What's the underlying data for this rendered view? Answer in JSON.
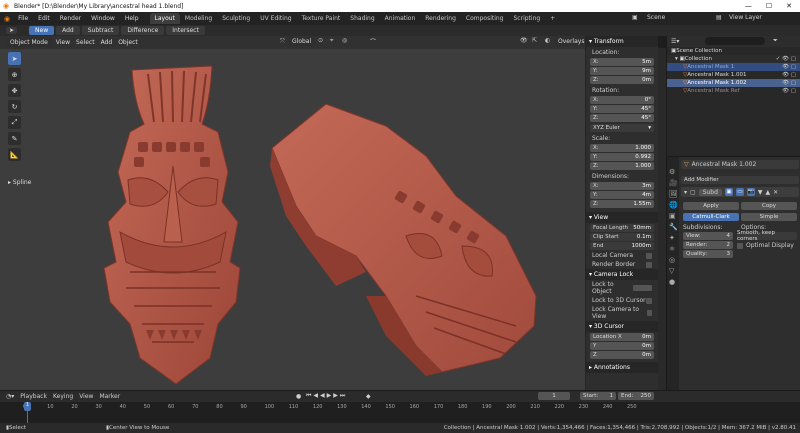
{
  "window": {
    "title": "Blender* [D:\\Blender\\My Library\\ancestral head 1.blend]"
  },
  "menus": [
    "File",
    "Edit",
    "Render",
    "Window",
    "Help"
  ],
  "workspaces": [
    "Layout",
    "Modeling",
    "Sculpting",
    "UV Editing",
    "Texture Paint",
    "Shading",
    "Animation",
    "Rendering",
    "Compositing",
    "Scripting"
  ],
  "scene": {
    "label": "Scene",
    "view_layer": "View Layer"
  },
  "toolhdr": {
    "modes": [
      "New",
      "Add",
      "Subtract",
      "Difference",
      "Intersect"
    ]
  },
  "viewport": {
    "mode": "Object Mode",
    "menus": [
      "View",
      "Select",
      "Add",
      "Object"
    ],
    "orientation": "Global",
    "overlays": "Overlays",
    "shading": "Shading",
    "tool_label": "Spline"
  },
  "npanel": {
    "transform": "Transform",
    "location": "Location:",
    "loc": [
      [
        "X:",
        "5m"
      ],
      [
        "Y:",
        "9m"
      ],
      [
        "Z:",
        "0m"
      ]
    ],
    "rotation": "Rotation:",
    "rot": [
      [
        "X:",
        "0°"
      ],
      [
        "Y:",
        "45°"
      ],
      [
        "Z:",
        "45°"
      ]
    ],
    "euler": "XYZ Euler",
    "scale": "Scale:",
    "scl": [
      [
        "X:",
        "1.000"
      ],
      [
        "Y:",
        "0.992"
      ],
      [
        "Z:",
        "1.000"
      ]
    ],
    "dimensions": "Dimensions:",
    "dim": [
      [
        "X:",
        "3m"
      ],
      [
        "Y:",
        "4m"
      ],
      [
        "Z:",
        "1.55m"
      ]
    ],
    "view": "View",
    "focal_length": [
      "Focal Length",
      "50mm"
    ],
    "clip_start": [
      "Clip Start",
      "0.1m"
    ],
    "clip_end": [
      "End",
      "1000m"
    ],
    "local_camera": "Local Camera",
    "render_border": "Render Border",
    "camera_lock": "Camera Lock",
    "lock_to_object": "Lock to Object",
    "lock_to_3d_cursor": "Lock to 3D Cursor",
    "lock_camera_to_view": "Lock Camera to View",
    "cursor": "3D Cursor",
    "cursor_loc": [
      [
        "Location X",
        "0m"
      ],
      [
        "Y",
        "0m"
      ],
      [
        "Z",
        "0m"
      ]
    ],
    "annotations": "Annotations"
  },
  "outliner": {
    "title": "Scene Collection",
    "collection": "Collection",
    "items": [
      "Ancestral Mask 1",
      "Ancestral Mask 1.001",
      "Ancestral Mask 1.002",
      "Ancestral Mask Ref"
    ]
  },
  "properties": {
    "object_name": "Ancestral Mask 1.002",
    "add_modifier": "Add Modifier",
    "mod_name": "Subd",
    "apply": "Apply",
    "copy": "Copy",
    "catmull": "Catmull-Clark",
    "simple": "Simple",
    "subdivisions": "Subdivisions:",
    "options": "Options:",
    "view": [
      "View:",
      "4"
    ],
    "render": [
      "Render:",
      "2"
    ],
    "quality": [
      "Quality:",
      "3"
    ],
    "smooth": "Smooth, keep corners",
    "optimal": "Optimal Display"
  },
  "timeline": {
    "menus": [
      "Playback",
      "Keying",
      "View",
      "Marker"
    ],
    "current": "1",
    "start_label": "Start:",
    "start": "1",
    "end_label": "End:",
    "end": "250",
    "ticks": [
      "0",
      "10",
      "20",
      "30",
      "40",
      "50",
      "60",
      "70",
      "80",
      "90",
      "100",
      "110",
      "120",
      "130",
      "140",
      "150",
      "160",
      "170",
      "180",
      "190",
      "200",
      "210",
      "220",
      "230",
      "240",
      "250"
    ]
  },
  "status": {
    "select": "Select",
    "center": "Center View to Mouse",
    "stats": "Collection | Ancestral Mask 1.002 | Verts:1,354,466 | Faces:1,354,466 | Tris:2,708,992 | Objects:1/2 | Mem: 367.2 MiB | v2.80.41"
  },
  "colors": {
    "accent": "#4772b3",
    "mask": "#b75848",
    "viewport_bg": "#3d3d3d"
  }
}
